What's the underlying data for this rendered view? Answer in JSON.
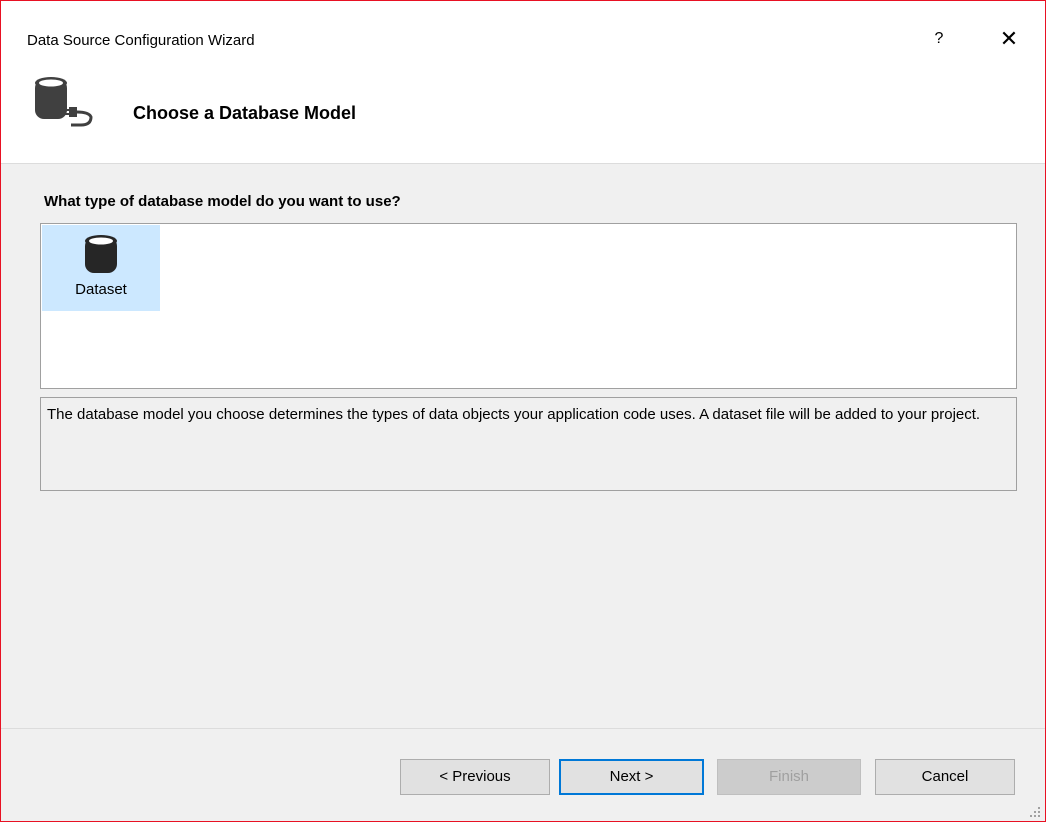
{
  "window": {
    "title": "Data Source Configuration Wizard",
    "help_label": "?",
    "close_label": "✕"
  },
  "header": {
    "title": "Choose a Database Model",
    "icon": "database-plug-icon"
  },
  "main": {
    "question": "What type of database model do you want to use?",
    "models": [
      {
        "label": "Dataset",
        "icon": "database-icon",
        "selected": true
      }
    ],
    "description": "The database model you choose determines the types of data objects your application code uses. A dataset file will be added to your project."
  },
  "footer": {
    "previous_label": "< Previous",
    "next_label": "Next >",
    "finish_label": "Finish",
    "finish_enabled": false,
    "cancel_label": "Cancel"
  },
  "colors": {
    "selection": "#cce8ff",
    "accent": "#0078d7",
    "window_border": "#e81123"
  }
}
